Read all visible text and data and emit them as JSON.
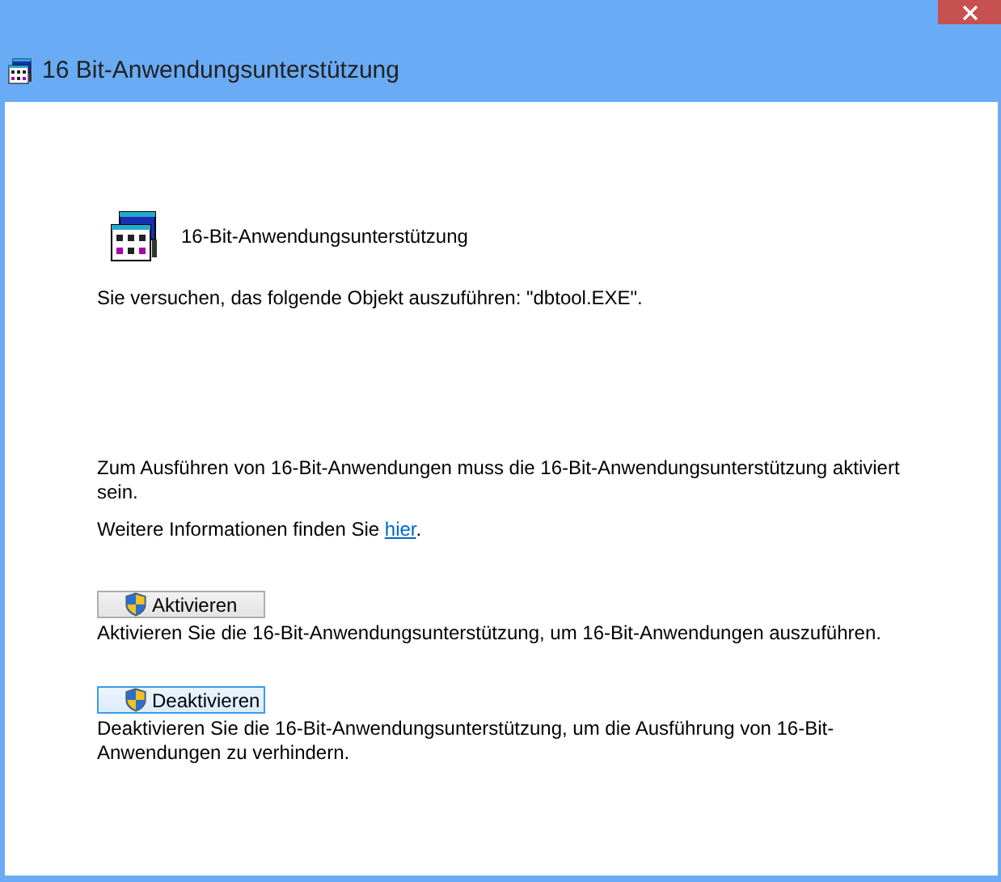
{
  "window": {
    "title": "16 Bit-Anwendungsunterstützung"
  },
  "header": {
    "title": "16-Bit-Anwendungsunterstützung"
  },
  "attempt_message": "Sie versuchen, das folgende Objekt auszuführen: \"dbtool.EXE\".",
  "requirement_message": "Zum Ausführen von 16-Bit-Anwendungen muss die 16-Bit-Anwendungsunterstützung aktiviert sein.",
  "info": {
    "text": "Weitere Informationen finden Sie ",
    "link": "hier",
    "suffix": "."
  },
  "actions": [
    {
      "label": "Aktivieren",
      "focused": false,
      "description": "Aktivieren Sie die 16-Bit-Anwendungsunterstützung, um 16-Bit-Anwendungen auszuführen."
    },
    {
      "label": "Deaktivieren",
      "focused": true,
      "description": "Deaktivieren Sie die 16-Bit-Anwendungsunterstützung, um die Ausführung von 16-Bit-Anwendungen zu verhindern."
    }
  ]
}
